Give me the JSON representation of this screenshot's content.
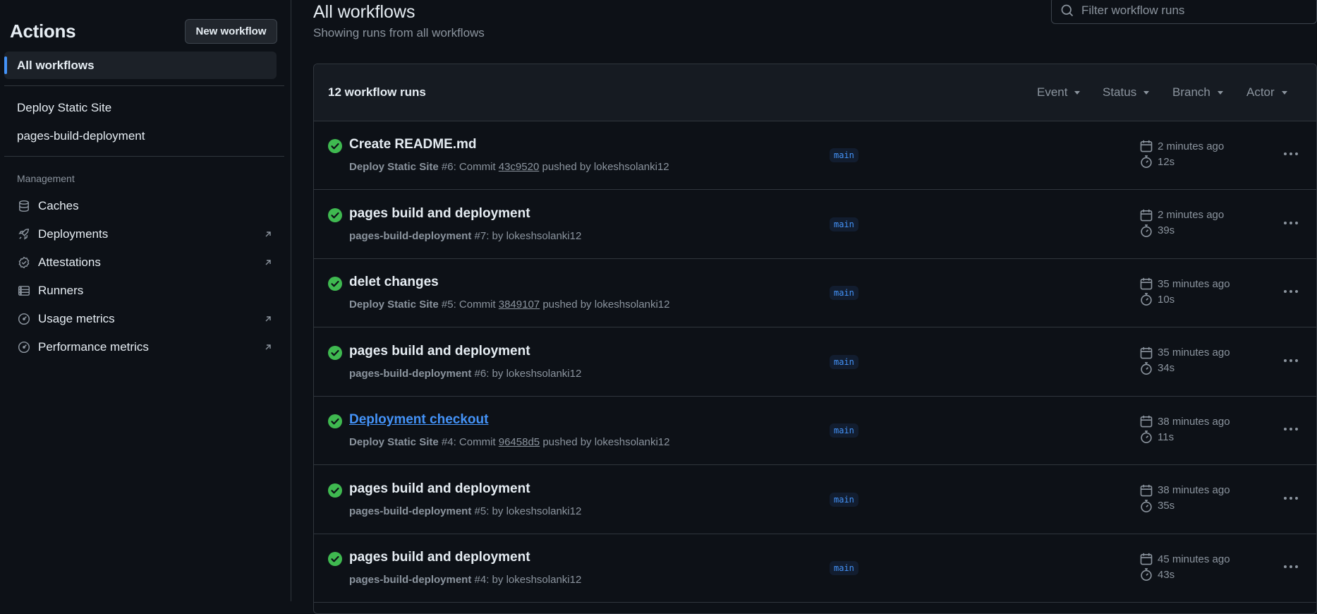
{
  "sidebar": {
    "title": "Actions",
    "new_workflow_label": "New workflow",
    "all_workflows_label": "All workflows",
    "workflows": [
      "Deploy Static Site",
      "pages-build-deployment"
    ],
    "management_heading": "Management",
    "management_items": [
      {
        "label": "Caches",
        "icon": "database-icon",
        "external": false
      },
      {
        "label": "Deployments",
        "icon": "rocket-icon",
        "external": true
      },
      {
        "label": "Attestations",
        "icon": "verified-icon",
        "external": true
      },
      {
        "label": "Runners",
        "icon": "server-icon",
        "external": false
      },
      {
        "label": "Usage metrics",
        "icon": "meter-icon",
        "external": true
      },
      {
        "label": "Performance metrics",
        "icon": "meter-icon",
        "external": true
      }
    ]
  },
  "main": {
    "title": "All workflows",
    "subtitle": "Showing runs from all workflows",
    "filter_placeholder": "Filter workflow runs",
    "runs_count": "12 workflow runs",
    "filters": [
      "Event",
      "Status",
      "Branch",
      "Actor"
    ]
  },
  "runs": [
    {
      "title": "Create README.md",
      "workflow": "Deploy Static Site",
      "number": "#6",
      "commit": "43c9520",
      "actor": "lokeshsolanki12",
      "branch": "main",
      "time": "2 minutes ago",
      "duration": "12s",
      "link": false
    },
    {
      "title": "pages build and deployment",
      "workflow": "pages-build-deployment",
      "number": "#7",
      "commit": "",
      "actor": "lokeshsolanki12",
      "branch": "main",
      "time": "2 minutes ago",
      "duration": "39s",
      "link": false
    },
    {
      "title": "delet changes",
      "workflow": "Deploy Static Site",
      "number": "#5",
      "commit": "3849107",
      "actor": "lokeshsolanki12",
      "branch": "main",
      "time": "35 minutes ago",
      "duration": "10s",
      "link": false
    },
    {
      "title": "pages build and deployment",
      "workflow": "pages-build-deployment",
      "number": "#6",
      "commit": "",
      "actor": "lokeshsolanki12",
      "branch": "main",
      "time": "35 minutes ago",
      "duration": "34s",
      "link": false
    },
    {
      "title": "Deployment checkout",
      "workflow": "Deploy Static Site",
      "number": "#4",
      "commit": "96458d5",
      "actor": "lokeshsolanki12",
      "branch": "main",
      "time": "38 minutes ago",
      "duration": "11s",
      "link": true
    },
    {
      "title": "pages build and deployment",
      "workflow": "pages-build-deployment",
      "number": "#5",
      "commit": "",
      "actor": "lokeshsolanki12",
      "branch": "main",
      "time": "38 minutes ago",
      "duration": "35s",
      "link": false
    },
    {
      "title": "pages build and deployment",
      "workflow": "pages-build-deployment",
      "number": "#4",
      "commit": "",
      "actor": "lokeshsolanki12",
      "branch": "main",
      "time": "45 minutes ago",
      "duration": "43s",
      "link": false
    }
  ],
  "strings": {
    "commit_word": "Commit",
    "pushed_by": "pushed by",
    "by": "by"
  },
  "colors": {
    "background": "#0d1117",
    "accent": "#4493f8",
    "success": "#3fb950",
    "muted": "#8b949e"
  }
}
